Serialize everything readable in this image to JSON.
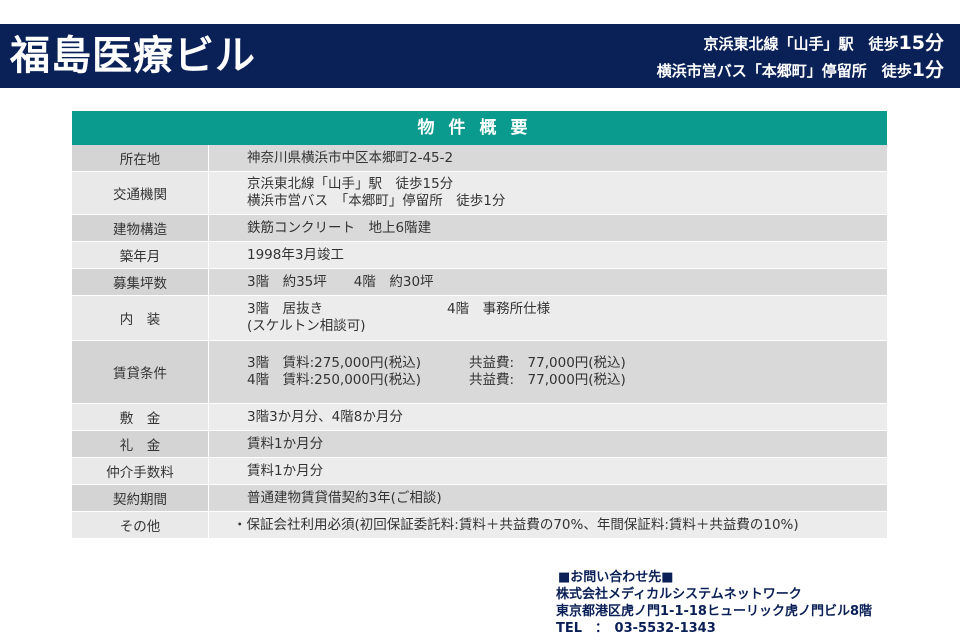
{
  "header": {
    "title": "福島医療ビル",
    "access_line1": "京浜東北線「山手」駅　徒歩",
    "access_line1_min": "15分",
    "access_line2": "横浜市営バス「本郷町」停留所　徒歩",
    "access_line2_min": "1分"
  },
  "table": {
    "title": "物件概要",
    "rows": [
      {
        "label": "所在地",
        "value1": "神奈川県横浜市中区本郷町2-45-2"
      },
      {
        "label": "交通機関",
        "value1": "京浜東北線「山手」駅　徒歩15分",
        "value2": "横浜市営バス　「本郷町」停留所　徒歩1分"
      },
      {
        "label": "建物構造",
        "value1": "鉄筋コンクリート　地上6階建"
      },
      {
        "label": "築年月",
        "value1": "1998年3月竣工"
      },
      {
        "label": "募集坪数",
        "value1": "3階　約35坪　　4階　約30坪"
      },
      {
        "label": "内　装",
        "value1a": "3階　居抜き",
        "value1b": "4階　事務所仕様",
        "value2": "(スケルトン相談可)"
      },
      {
        "label": "賃貸条件",
        "value1a": "3階　賃料:275,000円(税込)",
        "value1b": "共益費:　77,000円(税込)",
        "value2a": "4階　賃料:250,000円(税込)",
        "value2b": "共益費:　77,000円(税込)"
      },
      {
        "label": "敷　金",
        "value1": "3階3か月分、4階8か月分"
      },
      {
        "label": "礼　金",
        "value1": "賃料1か月分"
      },
      {
        "label": "仲介手数料",
        "value1": "賃料1か月分"
      },
      {
        "label": "契約期間",
        "value1": "普通建物賃貸借契約3年(ご相談)"
      },
      {
        "label": "その他",
        "value1": "・保証会社利用必須(初回保証委託料:賃料＋共益費の70%、年間保証料:賃料＋共益費の10%)"
      }
    ]
  },
  "contact": {
    "heading": "■お問い合わせ先■",
    "company": "株式会社メディカルシステムネットワーク",
    "address": "東京都港区虎ノ門1-1-18ヒューリック虎ノ門ビル8階",
    "tel": "TEL　：　03-5532-1343"
  },
  "colors": {
    "header_bg": "#0a2157",
    "table_title_bg": "#0b9a8e",
    "row_light": "#ececec",
    "row_dark": "#d9d9d9"
  }
}
